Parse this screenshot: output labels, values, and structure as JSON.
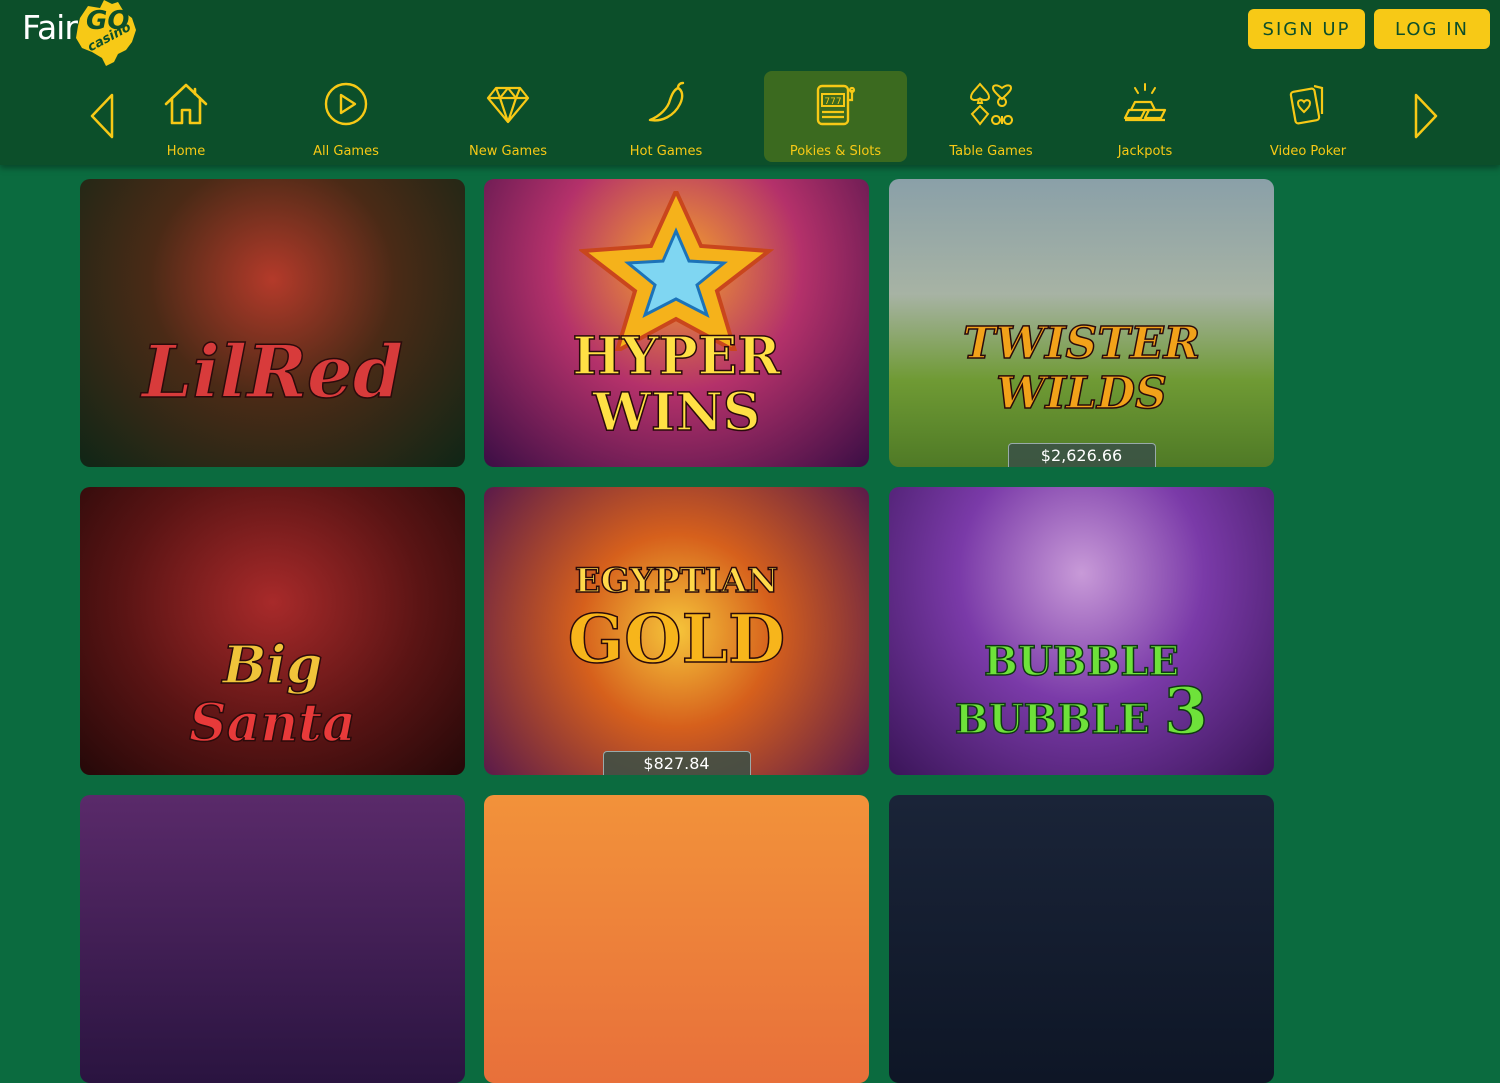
{
  "brand": {
    "name_part1": "Fair",
    "name_part2": "GO",
    "name_part3": "casino"
  },
  "header": {
    "signup_label": "SIGN UP",
    "login_label": "LOG IN"
  },
  "nav": {
    "items": [
      {
        "label": "Home",
        "icon": "home-icon"
      },
      {
        "label": "All Games",
        "icon": "play-icon"
      },
      {
        "label": "New Games",
        "icon": "diamond-icon"
      },
      {
        "label": "Hot Games",
        "icon": "chili-icon"
      },
      {
        "label": "Pokies & Slots",
        "icon": "slot-machine-icon",
        "active": true
      },
      {
        "label": "Table Games",
        "icon": "card-suits-icon"
      },
      {
        "label": "Jackpots",
        "icon": "gold-bars-icon"
      },
      {
        "label": "Video Poker",
        "icon": "playing-card-icon"
      }
    ]
  },
  "games": [
    {
      "title_line1": "Lil",
      "title_line2": "Red",
      "jackpot": ""
    },
    {
      "title_line1": "HYPER",
      "title_line2": "WINS",
      "jackpot": ""
    },
    {
      "title_line1": "TWISTER",
      "title_line2": "WILDS",
      "jackpot": "$2,626.66"
    },
    {
      "title_line1": "Big",
      "title_line2": "Santa",
      "jackpot": ""
    },
    {
      "title_line1": "EGYPTIAN",
      "title_line2": "GOLD",
      "jackpot": "$827.84"
    },
    {
      "title_line1": "BUBBLE BUBBLE",
      "title_line2": "3",
      "jackpot": ""
    }
  ],
  "colors": {
    "accent": "#f7c916",
    "header_bg": "#0c4f2a",
    "page_bg": "#0b6b3f",
    "active_nav_bg": "#3b6a1f"
  }
}
